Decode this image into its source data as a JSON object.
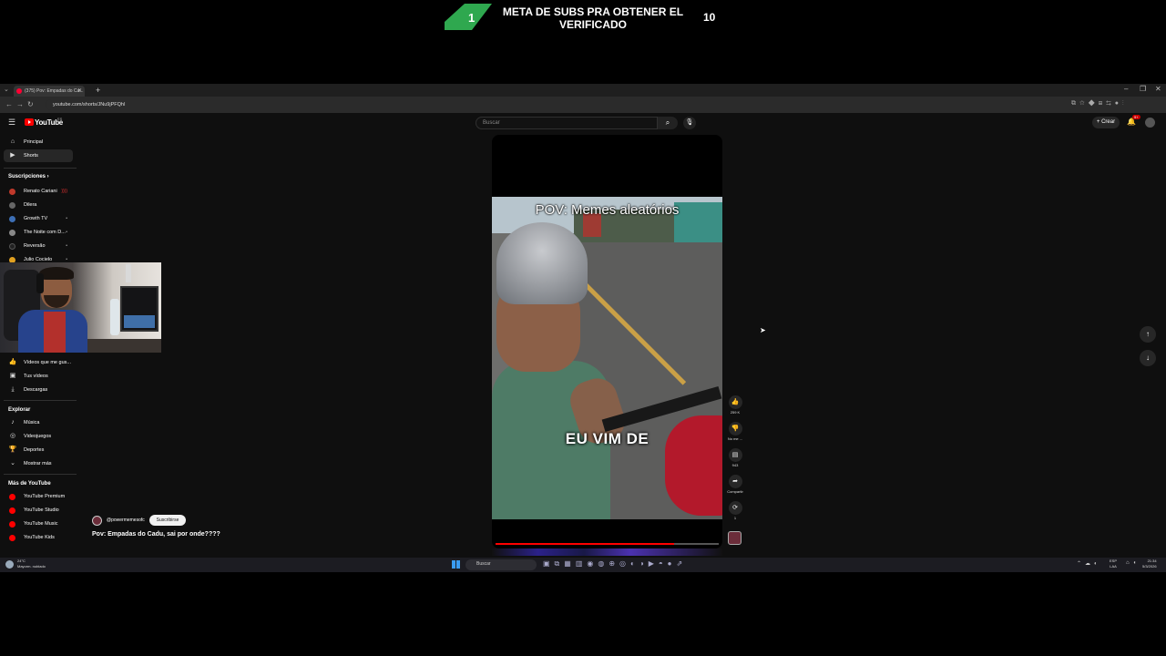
{
  "stream_overlay": {
    "goal_current": "1",
    "goal_title": "META DE SUBS PRA OBTENER EL VERIFICADO",
    "goal_target": "10",
    "accent_color": "#2fa84f"
  },
  "browser": {
    "tab_title": "(375) Pov: Empadas do Ca...",
    "url": "youtube.com/shorts/JNu9jPFQhI"
  },
  "youtube": {
    "wordmark": "YouTube",
    "country": "ES",
    "search_placeholder": "Buscar",
    "create_label": "Crear",
    "notification_count": "9+",
    "brand_color": "#ff0000"
  },
  "sidebar": {
    "main": [
      {
        "label": "Principal",
        "icon": "home-icon"
      },
      {
        "label": "Shorts",
        "icon": "shorts-icon",
        "active": true
      }
    ],
    "subscriptions_heading": "Suscripciones",
    "subscriptions": [
      {
        "label": "Renato Cariani",
        "badge": "))))",
        "color": "#c0392b"
      },
      {
        "label": "Dilera",
        "badge": "",
        "color": "#666"
      },
      {
        "label": "Growth TV",
        "badge": "•",
        "color": "#3d6fb5"
      },
      {
        "label": "The Noite com D...",
        "badge": "•",
        "color": "#888"
      },
      {
        "label": "Reversão",
        "badge": "•",
        "color": "#222"
      },
      {
        "label": "Julio Cocielo",
        "badge": "•",
        "color": "#e0a020"
      }
    ],
    "you_items": [
      {
        "label": "Vídeos que me gus...",
        "icon": "thumbs-up-icon"
      },
      {
        "label": "Tus vídeos",
        "icon": "video-icon"
      },
      {
        "label": "Descargas",
        "icon": "download-icon"
      }
    ],
    "explore_heading": "Explorar",
    "explore": [
      {
        "label": "Música",
        "icon": "music-icon"
      },
      {
        "label": "Videojuegos",
        "icon": "gaming-icon"
      },
      {
        "label": "Deportes",
        "icon": "trophy-icon"
      },
      {
        "label": "Mostrar más",
        "icon": "chevron-down-icon"
      }
    ],
    "more_heading": "Más de YouTube",
    "more": [
      {
        "label": "YouTube Premium"
      },
      {
        "label": "YouTube Studio"
      },
      {
        "label": "YouTube Music"
      },
      {
        "label": "YouTube Kids"
      }
    ]
  },
  "short": {
    "pov_caption": "POV: Memes aleatórios",
    "sub_caption": "EU VIM DE",
    "channel": "@powermemesofc",
    "subscribe_label": "Suscribirse",
    "title": "Pov: Empadas do Cadu, sai por onde????",
    "progress": 0.8,
    "likes": "259 K",
    "dislike_label": "No me ...",
    "comments": "943",
    "share_label": "Compartir",
    "remix_count": "1"
  },
  "taskbar": {
    "weather_temp": "24°C",
    "weather_text": "Mayorm. nublado",
    "search_label": "Buscar",
    "lang_top": "ESP",
    "lang_bottom": "LAA",
    "time": "21:34",
    "date": "5/3/2026"
  }
}
